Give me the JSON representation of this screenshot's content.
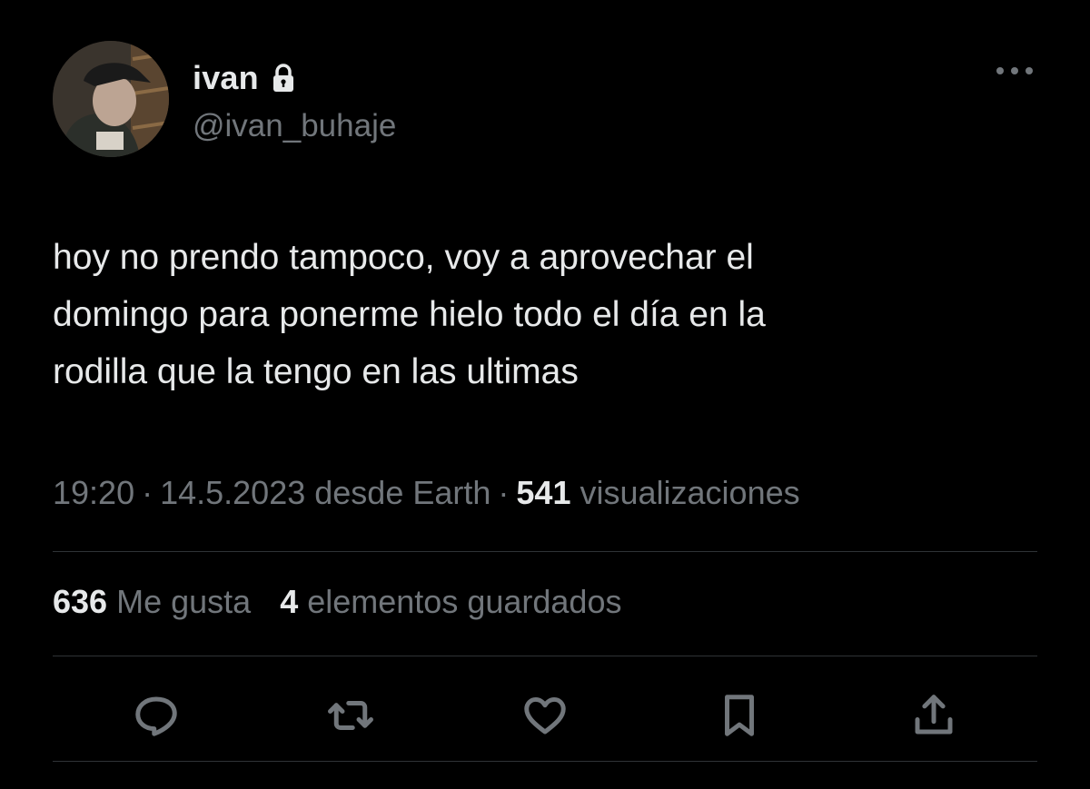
{
  "user": {
    "display_name": "ivan",
    "handle": "@ivan_buhaje",
    "avatar_icon": "profile-photo",
    "protected_icon": "lock-icon"
  },
  "more_icon": "more-horizontal-icon",
  "tweet": {
    "text": "hoy no prendo tampoco, voy a aprovechar el\ndomingo para ponerme hielo todo el día en la\nrodilla que la tengo en las ultimas"
  },
  "meta": {
    "time": "19:20",
    "date": "14.5.2023",
    "source": "desde Earth",
    "views_count": "541",
    "views_label": "visualizaciones"
  },
  "stats": {
    "likes_count": "636",
    "likes_label": "Me gusta",
    "bookmarks_count": "4",
    "bookmarks_label": "elementos guardados"
  },
  "actions": [
    {
      "name": "reply",
      "icon": "reply-icon"
    },
    {
      "name": "retweet",
      "icon": "retweet-icon"
    },
    {
      "name": "like",
      "icon": "heart-icon"
    },
    {
      "name": "bookmark",
      "icon": "bookmark-icon"
    },
    {
      "name": "share",
      "icon": "share-icon"
    }
  ],
  "colors": {
    "background": "#000000",
    "primary_text": "#e7e9ea",
    "secondary_text": "#71767b",
    "divider": "#2f3336"
  }
}
